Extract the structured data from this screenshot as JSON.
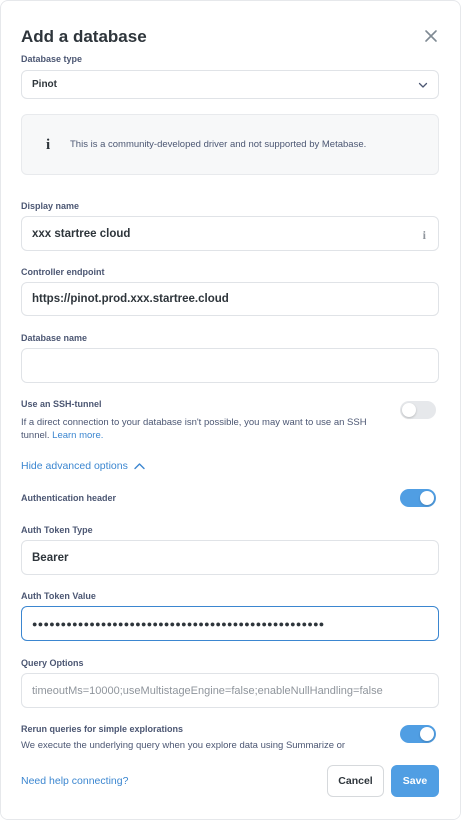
{
  "modal": {
    "title": "Add a database"
  },
  "database_type": {
    "label": "Database type",
    "value": "Pinot"
  },
  "notice": {
    "text": "This is a community-developed driver and not supported by Metabase."
  },
  "display_name": {
    "label": "Display name",
    "value": "xxx startree cloud"
  },
  "controller_endpoint": {
    "label": "Controller endpoint",
    "value": "https://pinot.prod.xxx.startree.cloud"
  },
  "database_name": {
    "label": "Database name",
    "value": ""
  },
  "ssh": {
    "label": "Use an SSH-tunnel",
    "description": "If a direct connection to your database isn't possible, you may want to use an SSH tunnel.",
    "learn_more": "Learn more.",
    "enabled": false
  },
  "advanced": {
    "toggle_label": "Hide advanced options"
  },
  "auth_header": {
    "label": "Authentication header",
    "enabled": true
  },
  "auth_token_type": {
    "label": "Auth Token Type",
    "value": "Bearer"
  },
  "auth_token_value": {
    "label": "Auth Token Value",
    "masked": "●●●●●●●●●●●●●●●●●●●●●●●●●●●●●●●●●●●●●●●●●●●●●●●●●●●"
  },
  "query_options": {
    "label": "Query Options",
    "placeholder": "timeoutMs=10000;useMultistageEngine=false;enableNullHandling=false"
  },
  "rerun": {
    "label": "Rerun queries for simple explorations",
    "description": "We execute the underlying query when you explore data using Summarize or",
    "enabled": true
  },
  "footer": {
    "help_link": "Need help connecting?",
    "cancel_label": "Cancel",
    "save_label": "Save"
  },
  "colors": {
    "accent": "#509ee3",
    "link": "#3b86d0",
    "text_dark": "#2e353b"
  }
}
